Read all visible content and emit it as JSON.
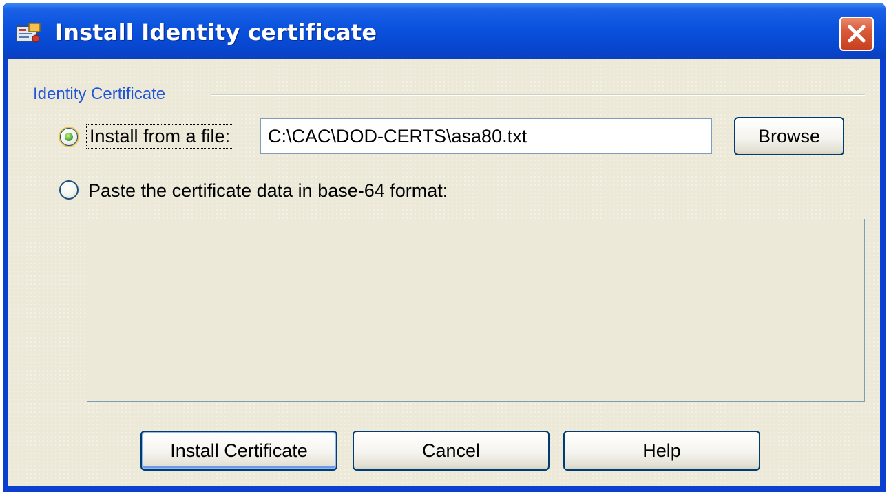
{
  "window": {
    "title": "Install Identity certificate",
    "title_icon": "certificate-app-icon",
    "close_icon": "close-icon",
    "accent_color": "#0a52dd",
    "close_color": "#d95a3a"
  },
  "group": {
    "label": "Identity Certificate"
  },
  "options": [
    {
      "label": "Install from a file:",
      "selected": true
    },
    {
      "label": "Paste the certificate data in base-64 format:",
      "selected": false
    }
  ],
  "file_input": {
    "value": "C:\\CAC\\DOD-CERTS\\asa80.txt"
  },
  "buttons": {
    "browse": "Browse",
    "install": "Install Certificate",
    "cancel": "Cancel",
    "help": "Help"
  }
}
